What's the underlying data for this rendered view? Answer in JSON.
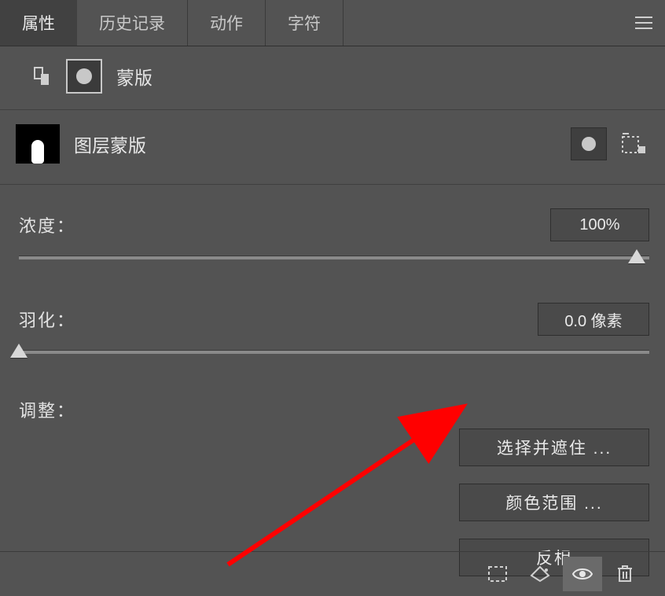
{
  "tabs": [
    "属性",
    "历史记录",
    "动作",
    "字符"
  ],
  "mask_header": {
    "title": "蒙版"
  },
  "layer": {
    "name": "图层蒙版"
  },
  "density": {
    "label": "浓度：",
    "value": "100%",
    "thumb_pct": 98
  },
  "feather": {
    "label": "羽化：",
    "value": "0.0 像素",
    "thumb_pct": 0
  },
  "refine": {
    "label": "调整：",
    "buttons": [
      "选择并遮住 ...",
      "颜色范围 ...",
      "反相"
    ]
  }
}
